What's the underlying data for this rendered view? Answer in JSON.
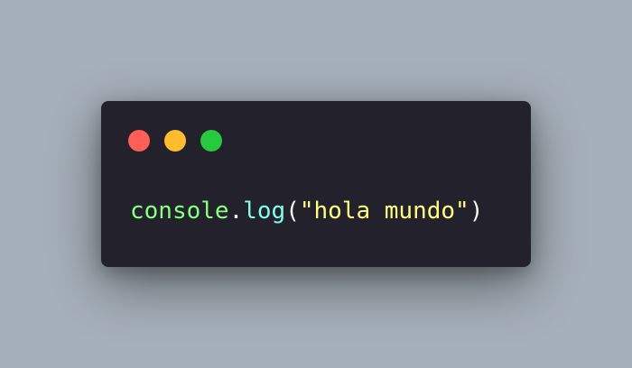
{
  "window": {
    "controls": [
      {
        "name": "close",
        "color": "#ff5f56"
      },
      {
        "name": "minimize",
        "color": "#ffbd2e"
      },
      {
        "name": "maximize",
        "color": "#27c93f"
      }
    ]
  },
  "code": {
    "tokens": [
      {
        "text": "console",
        "color": "#8aff80"
      },
      {
        "text": ".",
        "color": "#f8f8f2"
      },
      {
        "text": "log",
        "color": "#80ffea"
      },
      {
        "text": "(",
        "color": "#f8f8f2"
      },
      {
        "text": "\"hola mundo\"",
        "color": "#ffff80"
      },
      {
        "text": ")",
        "color": "#f8f8f2"
      }
    ]
  },
  "theme": {
    "background": "#a6b0ba",
    "window_background": "#22212c"
  }
}
